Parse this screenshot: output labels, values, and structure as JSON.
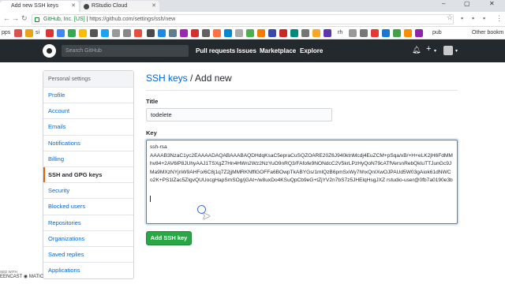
{
  "browser": {
    "tabs": [
      {
        "label": "Add new SSH keys",
        "active": true
      },
      {
        "label": "RStudio Cloud",
        "active": false
      }
    ],
    "omnibox": {
      "secure_label": "GitHub, Inc. [US]",
      "url": "https://github.com/settings/ssh/new"
    },
    "bookmarks": {
      "first_label": "pps",
      "si": "si",
      "rh": "rh",
      "pub": "pub",
      "other": "Other bookm"
    }
  },
  "header": {
    "search_placeholder": "Search GitHub",
    "nav": [
      "Pull requests",
      "Issues",
      "Marketplace",
      "Explore"
    ],
    "plus": "+",
    "caret": "▾"
  },
  "sidebar": {
    "heading": "Personal settings",
    "items": [
      {
        "label": "Profile",
        "selected": false
      },
      {
        "label": "Account",
        "selected": false
      },
      {
        "label": "Emails",
        "selected": false
      },
      {
        "label": "Notifications",
        "selected": false
      },
      {
        "label": "Billing",
        "selected": false
      },
      {
        "label": "SSH and GPG keys",
        "selected": true
      },
      {
        "label": "Security",
        "selected": false
      },
      {
        "label": "Blocked users",
        "selected": false
      },
      {
        "label": "Repositories",
        "selected": false
      },
      {
        "label": "Organizations",
        "selected": false
      },
      {
        "label": "Saved replies",
        "selected": false
      },
      {
        "label": "Applications",
        "selected": false
      }
    ]
  },
  "main": {
    "title_link": "SSH keys",
    "title_rest": " / Add new",
    "title_label": "Title",
    "title_value": "todelete",
    "key_label": "Key",
    "key_value": "ssh-rsa\nAAAAB3NzaC1yc2EAAAADAQABAAABAQDHdqKsaC5epraCuSQZOARE20Z6J940ktnMcdj4EuZCM+pSqa/xB/+H+eLK2jH6FdMMhv84+2AV6lP8JUhyAAJ1TSXgZ7Hn4HWn2Wz2NzYuO9nRQ3/FAfofe9NONdcC2V5krLPzHyQoN79cATfVersnRebQkIuTTJunGc9JMa9MXzNYjnW9AHFo/6C8j1q7Z2jjMMRKNfflGOFFa6BOwpTkABYGs/1mlQzB6pmSxWy7hhxQnIXwOJPAUd5W03gAiok61dNWCo2K+PS1lZac5ZIgvQUUocgHapSmSOg/jGAt+/w8uxDo4KSuQpCb9eG+tZjYV2n7bS7z5JHElqHsgJXZ rstudio-user@0fb7a0190e3b",
    "add_button": "Add SSH key"
  },
  "watermark": {
    "small": "SED WITH",
    "brand": "EENCAST",
    "brand2": "MATIC"
  }
}
